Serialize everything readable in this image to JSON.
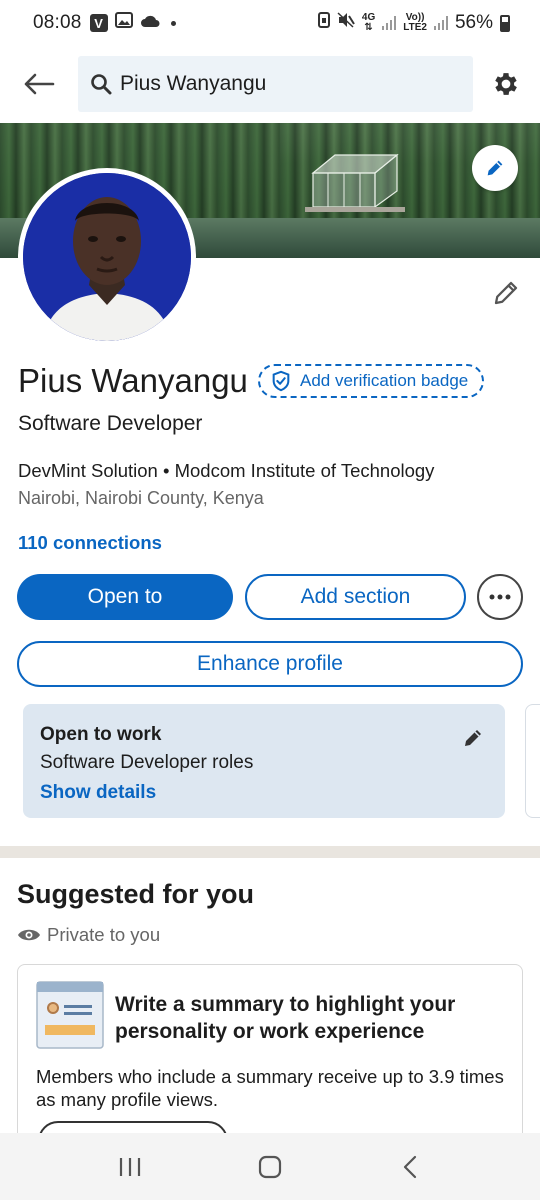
{
  "status_bar": {
    "time": "08:08",
    "battery": "56%",
    "network_top": "4G",
    "network_volte": "Vo))",
    "network_lte": "LTE2"
  },
  "header": {
    "search_value": "Pius Wanyangu"
  },
  "profile": {
    "name": "Pius Wanyangu",
    "verify_badge": "Add verification badge",
    "headline": "Software Developer",
    "company_line": "DevMint Solution • Modcom Institute of Technology",
    "location": "Nairobi, Nairobi County, Kenya",
    "connections": "110 connections"
  },
  "actions": {
    "open_to": "Open to",
    "add_section": "Add section",
    "enhance_profile": "Enhance profile"
  },
  "open_to_work": {
    "title": "Open to work",
    "roles": "Software Developer roles",
    "show_details": "Show details"
  },
  "suggested": {
    "title": "Suggested for you",
    "privacy": "Private to you",
    "card_heading": "Write a summary to highlight your personality or work experience",
    "card_body": "Members who include a summary receive up to 3.9 times as many profile views."
  },
  "colors": {
    "brand_blue": "#0a66c2",
    "card_bg": "#dde7f1",
    "search_bg": "#edf3f8"
  },
  "icons": [
    "back-arrow-icon",
    "search-icon",
    "gear-icon",
    "pencil-icon",
    "shield-check-icon",
    "more-icon",
    "eye-icon"
  ]
}
